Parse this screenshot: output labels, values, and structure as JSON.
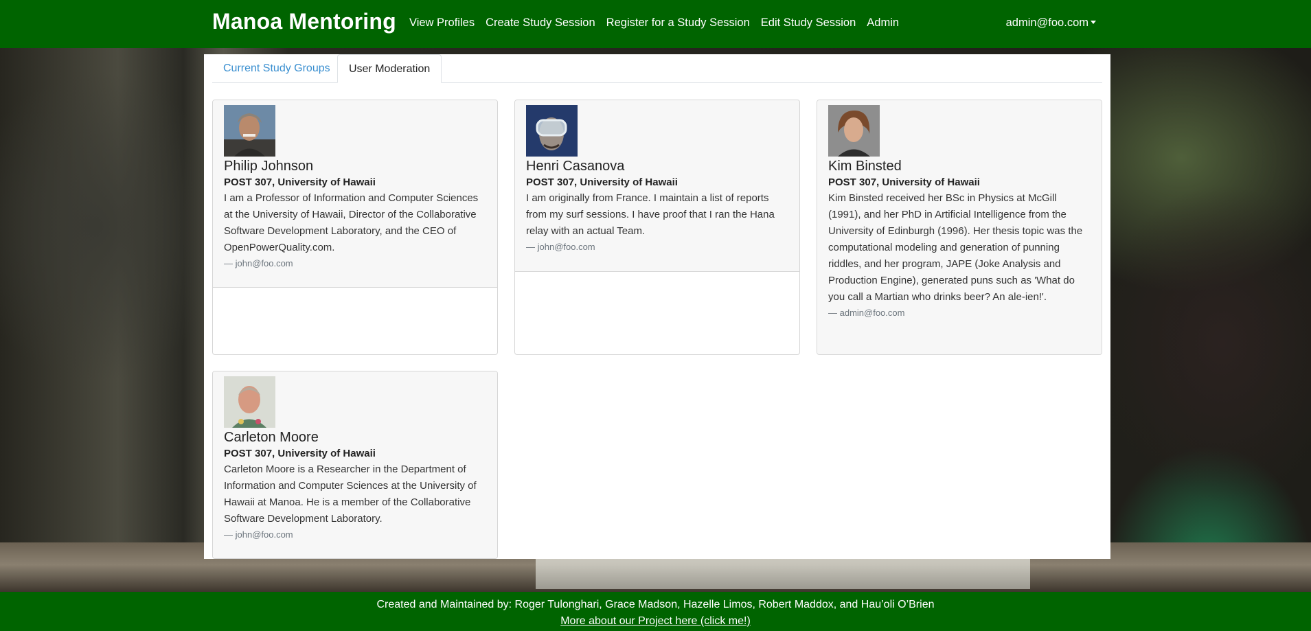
{
  "navbar": {
    "brand": "Manoa Mentoring",
    "links": [
      "View Profiles",
      "Create Study Session",
      "Register for a Study Session",
      "Edit Study Session",
      "Admin"
    ],
    "user": "admin@foo.com"
  },
  "tabs": [
    {
      "label": "Current Study Groups",
      "active": false
    },
    {
      "label": "User Moderation",
      "active": true
    }
  ],
  "profiles": [
    {
      "name": "Philip Johnson",
      "affiliation": "POST 307, University of Hawaii",
      "description": "I am a Professor of Information and Computer Sciences at the University of Hawaii, Director of the Collaborative Software Development Laboratory, and the CEO of OpenPowerQuality.com.",
      "contact": "— john@foo.com",
      "avatar_icon": "portrait-icon"
    },
    {
      "name": "Henri Casanova",
      "affiliation": "POST 307, University of Hawaii",
      "description": "I am originally from France. I maintain a list of reports from my surf sessions. I have proof that I ran the Hana relay with an actual Team.",
      "contact": "— john@foo.com",
      "avatar_icon": "portrait-icon"
    },
    {
      "name": "Kim Binsted",
      "affiliation": "POST 307, University of Hawaii",
      "description": "Kim Binsted received her BSc in Physics at McGill (1991), and her PhD in Artificial Intelligence from the University of Edinburgh (1996). Her thesis topic was the computational modeling and generation of punning riddles, and her program, JAPE (Joke Analysis and Production Engine), generated puns such as 'What do you call a Martian who drinks beer? An ale-ien!'.",
      "contact": "— admin@foo.com",
      "avatar_icon": "portrait-icon"
    },
    {
      "name": "Carleton Moore",
      "affiliation": "POST 307, University of Hawaii",
      "description": "Carleton Moore is a Researcher in the Department of Information and Computer Sciences at the University of Hawaii at Manoa. He is a member of the Collaborative Software Development Laboratory.",
      "contact": "— john@foo.com",
      "avatar_icon": "portrait-icon"
    }
  ],
  "footer": {
    "credits": "Created and Maintained by: Roger Tulonghari, Grace Madson, Hazelle Limos, Robert Maddox, and Hau’oli O’Brien",
    "link": "More about our Project here (click me!)"
  },
  "colors": {
    "brand_green": "#006400",
    "link_blue": "#3a8fd0"
  }
}
